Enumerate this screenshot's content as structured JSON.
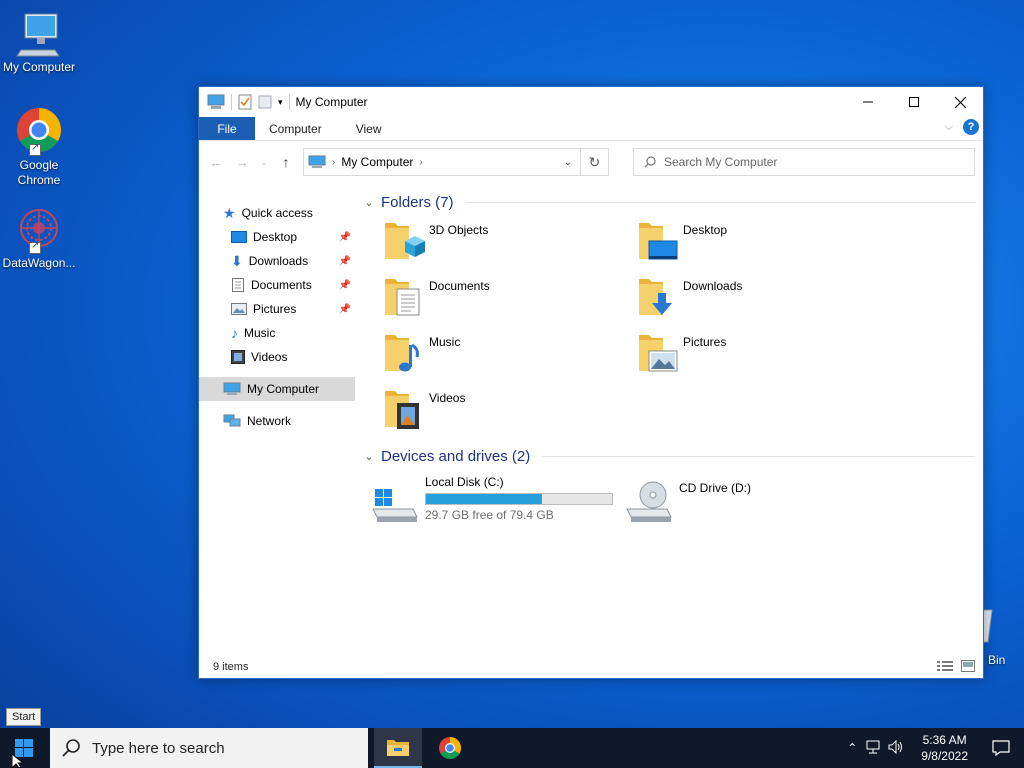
{
  "desktop": {
    "icons": [
      {
        "label": "My Computer"
      },
      {
        "label": "Google Chrome"
      },
      {
        "label": "DataWagon..."
      }
    ],
    "recycle_bin_label": "Bin"
  },
  "window": {
    "title": "My Computer",
    "ribbon_tabs": [
      "File",
      "Computer",
      "View"
    ],
    "address": {
      "crumb": "My Computer"
    },
    "search_placeholder": "Search My Computer",
    "nav": {
      "quick_access": "Quick access",
      "items": [
        {
          "label": "Desktop",
          "pinned": true
        },
        {
          "label": "Downloads",
          "pinned": true
        },
        {
          "label": "Documents",
          "pinned": true
        },
        {
          "label": "Pictures",
          "pinned": true
        },
        {
          "label": "Music",
          "pinned": false
        },
        {
          "label": "Videos",
          "pinned": false
        }
      ],
      "my_computer": "My Computer",
      "network": "Network"
    },
    "folders_group": "Folders (7)",
    "folders": [
      "3D Objects",
      "Desktop",
      "Documents",
      "Downloads",
      "Music",
      "Pictures",
      "Videos"
    ],
    "devices_group": "Devices and drives (2)",
    "drives": [
      {
        "name": "Local Disk (C:)",
        "free_text": "29.7 GB free of 79.4 GB",
        "used_fraction": 0.626
      },
      {
        "name": "CD Drive (D:)"
      }
    ],
    "status": "9 items"
  },
  "taskbar": {
    "search_placeholder": "Type here to search",
    "time": "5:36 AM",
    "date": "9/8/2022",
    "start_tooltip": "Start"
  },
  "colors": {
    "accent": "#1a5fb4",
    "drive_bar": "#26a0da",
    "folder": "#f4c54b"
  }
}
